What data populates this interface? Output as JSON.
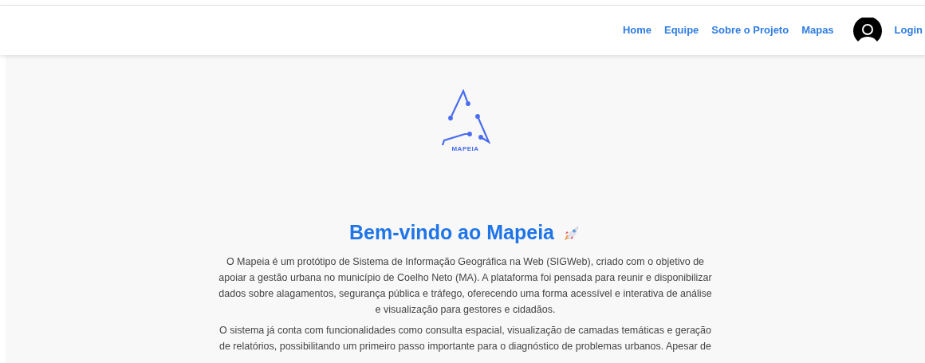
{
  "navbar": {
    "links": [
      {
        "label": "Home"
      },
      {
        "label": "Equipe"
      },
      {
        "label": "Sobre o Projeto"
      },
      {
        "label": "Mapas"
      }
    ],
    "login": "Login"
  },
  "logo": {
    "text": "MAPEIA"
  },
  "heading": "Bem-vindo ao Mapeia",
  "paragraphs": [
    "O Mapeia é um protótipo de Sistema de Informação Geográfica na Web (SIGWeb), criado com o objetivo de apoiar a gestão urbana no município de Coelho Neto (MA). A plataforma foi pensada para reunir e disponibilizar dados sobre alagamentos, segurança pública e tráfego, oferecendo uma forma acessível e interativa de análise e visualização para gestores e cidadãos.",
    "O sistema já conta com funcionalidades como consulta espacial, visualização de camadas temáticas e geração de relatórios, possibilitando um primeiro passo importante para o diagnóstico de problemas urbanos. Apesar de"
  ]
}
